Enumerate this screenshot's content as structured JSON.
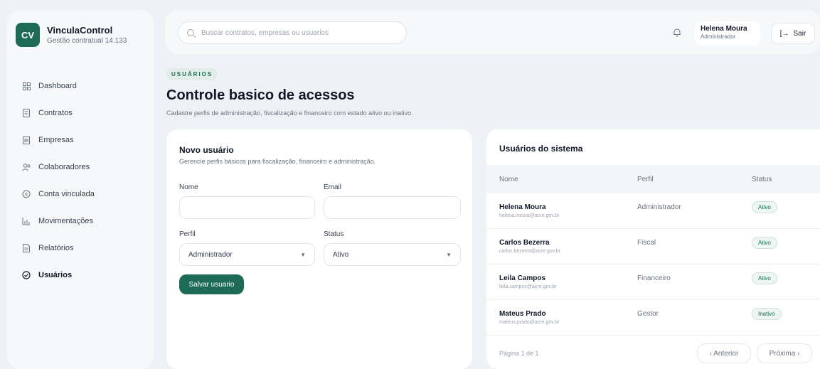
{
  "brand": {
    "logo": "CV",
    "name": "VinculaControl",
    "subtitle": "Gestão contratual 14.133"
  },
  "sidebar": {
    "items": [
      {
        "label": "Dashboard",
        "icon": "dashboard-icon"
      },
      {
        "label": "Contratos",
        "icon": "contracts-icon"
      },
      {
        "label": "Empresas",
        "icon": "companies-icon"
      },
      {
        "label": "Colaboradores",
        "icon": "collaborators-icon"
      },
      {
        "label": "Conta vinculada",
        "icon": "linked-account-icon"
      },
      {
        "label": "Movimentações",
        "icon": "movements-icon"
      },
      {
        "label": "Relatórios",
        "icon": "reports-icon"
      },
      {
        "label": "Usuários",
        "icon": "users-icon",
        "active": true
      }
    ]
  },
  "header": {
    "search_placeholder": "Buscar contratos, empresas ou usuarios",
    "user_name": "Helena Moura",
    "user_role": "Administrador",
    "logout_label": "Sair"
  },
  "page": {
    "eyebrow": "USUÁRIOS",
    "title": "Controle basico de acessos",
    "subtitle": "Cadastre perfis de administração, fiscalização e financeiro com estado ativo ou inativo."
  },
  "form": {
    "title": "Novo usuário",
    "subtitle": "Gerencie perfis básicos para fiscalização, financeiro e administração.",
    "name_label": "Nome",
    "name_value": "",
    "email_label": "Email",
    "email_value": "",
    "profile_label": "Perfil",
    "profile_value": "Administrador",
    "status_label": "Status",
    "status_value": "Ativo",
    "save_label": "Salvar usuario"
  },
  "users": {
    "title": "Usuários do sistema",
    "columns": [
      "Nome",
      "Perfil",
      "Status"
    ],
    "rows": [
      {
        "name": "Helena Moura",
        "email": "helena.moura@acre.gov.br",
        "profile": "Administrador",
        "status": "Ativo"
      },
      {
        "name": "Carlos Bezerra",
        "email": "carlos.bezerra@acre.gov.br",
        "profile": "Fiscal",
        "status": "Ativo"
      },
      {
        "name": "Leila Campos",
        "email": "leila.campos@acre.gov.br",
        "profile": "Financeiro",
        "status": "Ativo"
      },
      {
        "name": "Mateus Prado",
        "email": "mateus.prado@acre.gov.br",
        "profile": "Gestor",
        "status": "Inativo"
      }
    ],
    "page_info": "Página 1 de 1",
    "prev_label": "‹ Anterior",
    "next_label": "Próxima ›"
  },
  "colors": {
    "accent": "#1d6b57",
    "background": "#eef1f6"
  }
}
